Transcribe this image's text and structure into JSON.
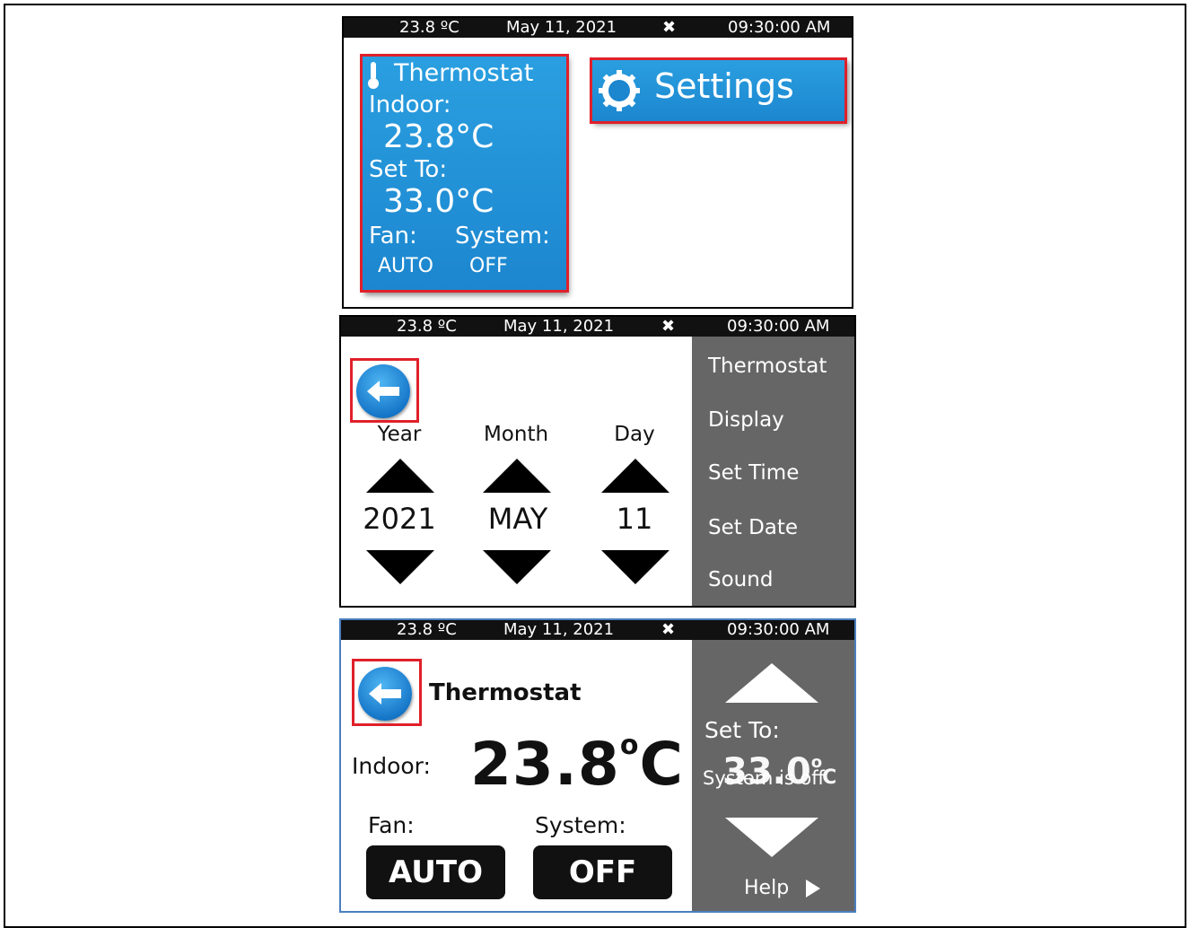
{
  "status_bar": {
    "temperature": "23.8 ºC",
    "date": "May 11, 2021",
    "time": "09:30:00 AM",
    "fan_icon": "fan-icon"
  },
  "home": {
    "thermostat_tile": {
      "title": "Thermostat",
      "indoor_label": "Indoor:",
      "indoor_value": "23.8°C",
      "set_to_label": "Set To:",
      "set_to_value": "33.0°C",
      "fan_label": "Fan:",
      "fan_value": "AUTO",
      "system_label": "System:",
      "system_value": "OFF",
      "icon": "thermometer-icon"
    },
    "settings_tile": {
      "label": "Settings",
      "icon": "gear-icon"
    }
  },
  "set_date": {
    "back_icon": "arrow-left-icon",
    "columns": [
      {
        "label": "Year",
        "value": "2021"
      },
      {
        "label": "Month",
        "value": "MAY"
      },
      {
        "label": "Day",
        "value": "11"
      }
    ],
    "menu": [
      "Thermostat",
      "Display",
      "Set Time",
      "Set Date",
      "Sound"
    ]
  },
  "thermostat": {
    "title": "Thermostat",
    "indoor_label": "Indoor:",
    "indoor_value": "23.8",
    "indoor_unit": "C",
    "degree_mark": "o",
    "fan_label": "Fan:",
    "fan_value": "AUTO",
    "system_label": "System:",
    "system_value": "OFF",
    "set_to_label": "Set To:",
    "set_to_value": "33.0",
    "set_to_unit": "C",
    "system_overlay": "System is off",
    "help_label": "Help"
  },
  "colors": {
    "tile_blue": "#1c86cf",
    "highlight_red": "#e0202a",
    "panel_gray": "#666666"
  }
}
